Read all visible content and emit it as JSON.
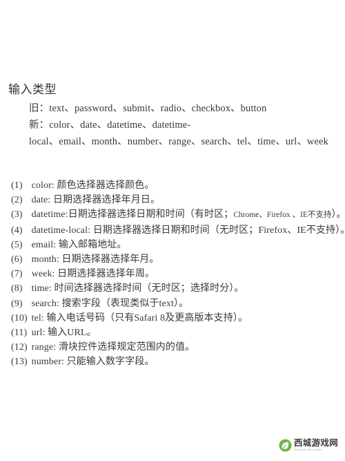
{
  "document": {
    "title": "输入类型",
    "intro_lines": [
      "旧：text、password、submit、radio、checkbox、button",
      "新：color、date、datetime、datetime-",
      "local、email、month、number、range、search、tel、time、url、week"
    ],
    "items": [
      {
        "index": "(1)",
        "name": "color:",
        "desc": "颜色选择器选择颜色。"
      },
      {
        "index": "(2)",
        "name": "date:",
        "desc": "日期选择器选择年月日。"
      },
      {
        "index": "(3)",
        "name": "datetime:",
        "desc_pre": "日期选择器选择日期和时间（有时区；",
        "desc_small": "Chrome、Firefox 、IE不支持",
        "desc_post": "）。"
      },
      {
        "index": "(4)",
        "name": "datetime-local:",
        "desc": "日期选择器选择日期和时间（无时区；Firefox、IE不支持）。"
      },
      {
        "index": "(5)",
        "name": "email:",
        "desc": "输入邮箱地址。"
      },
      {
        "index": "(6)",
        "name": "month:",
        "desc": "日期选择器选择年月。"
      },
      {
        "index": "(7)",
        "name": "week:",
        "desc": "日期选择器选择年周。"
      },
      {
        "index": "(8)",
        "name": "time:",
        "desc": "时间选择器选择时间（无时区；选择时分）。"
      },
      {
        "index": "(9)",
        "name": "search:",
        "desc": "搜索字段（表现类似于text）。"
      },
      {
        "index": "(10)",
        "name": "tel:",
        "desc": "输入电话号码（只有Safari 8及更高版本支持）。"
      },
      {
        "index": "(11)",
        "name": "url:",
        "desc": "输入URL。"
      },
      {
        "index": "(12)",
        "name": "range:",
        "desc": "滑块控件选择规定范围内的值。"
      },
      {
        "index": "(13)",
        "name": "number:",
        "desc": "只能输入数字字段。"
      }
    ]
  },
  "watermark": {
    "title": "西城游戏网",
    "subtitle": "XICHENG YOUXI WANG",
    "logo_color": "#63a832",
    "text_color": "#2b2b2b"
  },
  "colors": {
    "background": "#ffffff",
    "text": "#3a3a3a",
    "title": "#333333"
  }
}
